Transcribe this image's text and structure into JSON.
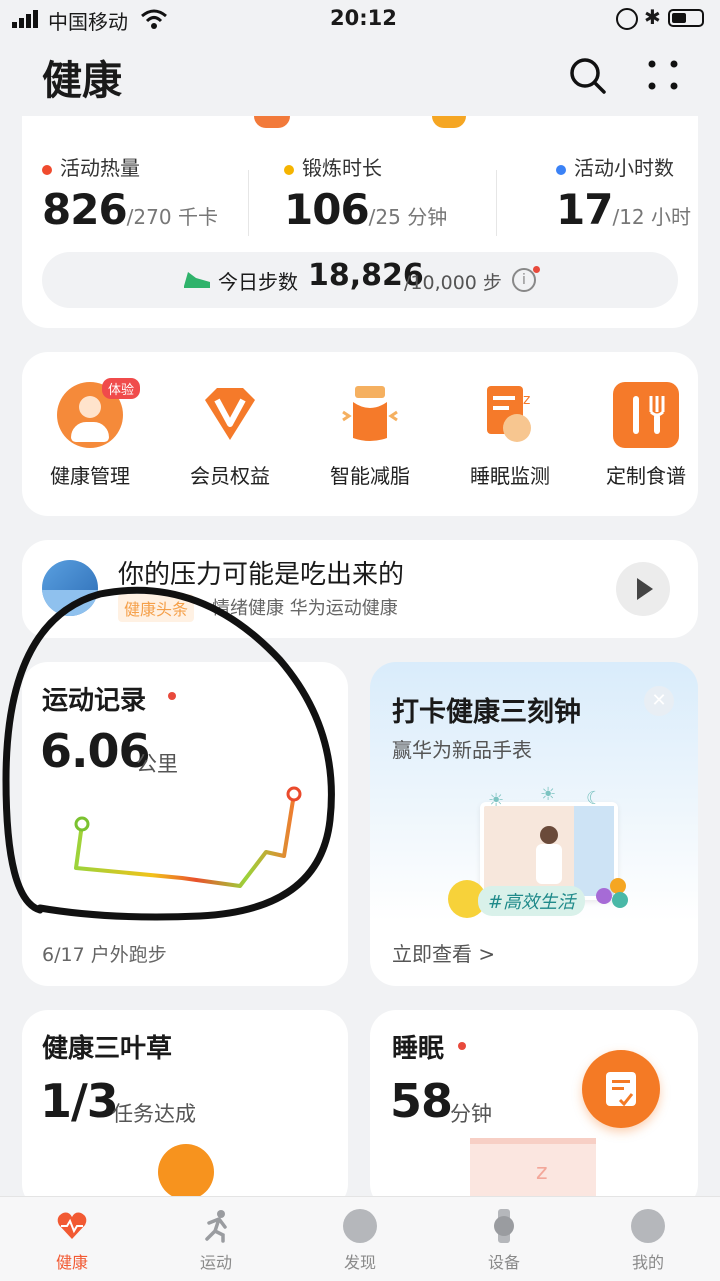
{
  "status_bar": {
    "carrier": "中国移动",
    "time": "20:12"
  },
  "header": {
    "title": "健康"
  },
  "activity": {
    "calories": {
      "label": "活动热量",
      "value": "826",
      "goal": "/270 千卡",
      "color": "#f04b2e"
    },
    "exercise": {
      "label": "锻炼时长",
      "value": "106",
      "goal": "/25 分钟",
      "color": "#f5b400"
    },
    "stand": {
      "label": "活动小时数",
      "value": "17",
      "goal": "/12 小时",
      "color": "#3b82f6"
    },
    "steps": {
      "label": "今日步数",
      "value": "18,826",
      "goal": "/10,000 步"
    }
  },
  "features": [
    {
      "label": "健康管理",
      "badge": "体验"
    },
    {
      "label": "会员权益"
    },
    {
      "label": "智能减脂"
    },
    {
      "label": "睡眠监测"
    },
    {
      "label": "定制食谱"
    }
  ],
  "article": {
    "title": "你的压力可能是吃出来的",
    "tag": "健康头条",
    "meta": "情绪健康 华为运动健康"
  },
  "workout_card": {
    "title": "运动记录",
    "value": "6.06",
    "unit": "公里",
    "footer": "6/17 户外跑步"
  },
  "promo_card": {
    "title": "打卡健康三刻钟",
    "subtitle": "赢华为新品手表",
    "hashtag": "#高效生活",
    "cta": "立即查看 >"
  },
  "clover_card": {
    "title": "健康三叶草",
    "value": "1/3",
    "unit": "任务达成"
  },
  "sleep_card": {
    "title": "睡眠",
    "value": "58",
    "unit": "分钟"
  },
  "bottom_nav": [
    {
      "label": "健康"
    },
    {
      "label": "运动"
    },
    {
      "label": "发现"
    },
    {
      "label": "设备"
    },
    {
      "label": "我的"
    }
  ],
  "colors": {
    "accent": "#f25a33",
    "background": "#f1f2f4"
  }
}
